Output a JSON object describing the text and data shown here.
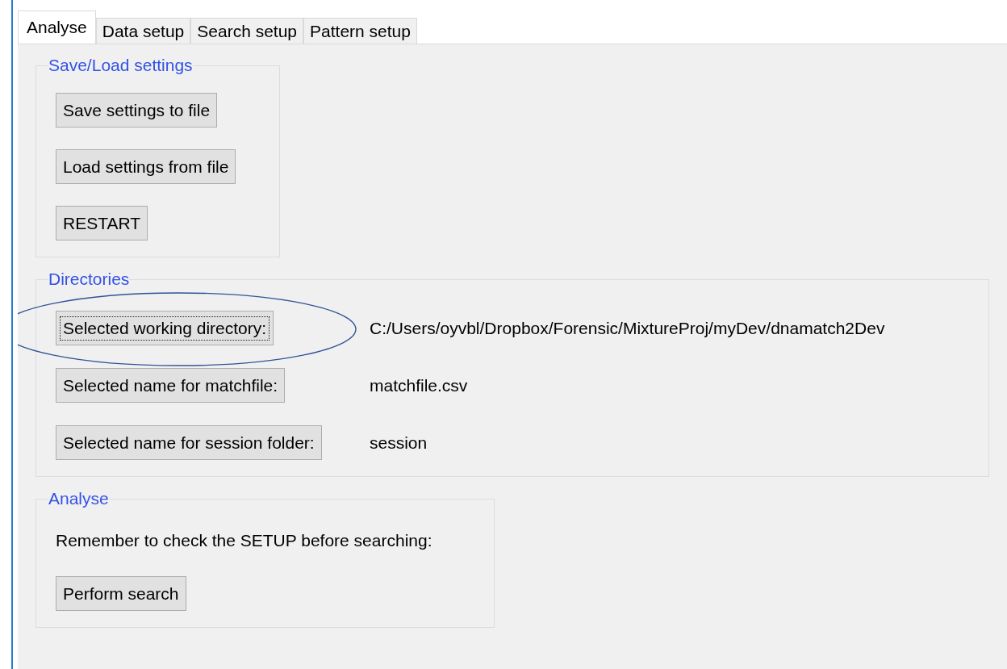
{
  "tabs": [
    {
      "label": "Analyse",
      "selected": true
    },
    {
      "label": "Data setup",
      "selected": false
    },
    {
      "label": "Search setup",
      "selected": false
    },
    {
      "label": "Pattern setup",
      "selected": false
    }
  ],
  "groups": [
    {
      "kind": "buttons",
      "title": "Save/Load settings",
      "buttons": [
        {
          "label": "Save settings to file",
          "focused": false
        },
        {
          "label": "Load settings from file",
          "focused": false
        },
        {
          "label": "RESTART",
          "focused": false
        }
      ]
    },
    {
      "kind": "pairs",
      "title": "Directories",
      "rows": [
        {
          "button": {
            "label": "Selected working directory:",
            "focused": true
          },
          "value": "C:/Users/oyvbl/Dropbox/Forensic/MixtureProj/myDev/dnamatch2Dev",
          "circled": true
        },
        {
          "button": {
            "label": "Selected name for matchfile:",
            "focused": false
          },
          "value": "matchfile.csv",
          "circled": false
        },
        {
          "button": {
            "label": "Selected name for session folder:",
            "focused": false
          },
          "value": "session",
          "circled": false
        }
      ]
    },
    {
      "kind": "note",
      "title": "Analyse",
      "text": "Remember to check the SETUP before searching:",
      "buttons": [
        {
          "label": "Perform search",
          "focused": false
        }
      ]
    }
  ]
}
